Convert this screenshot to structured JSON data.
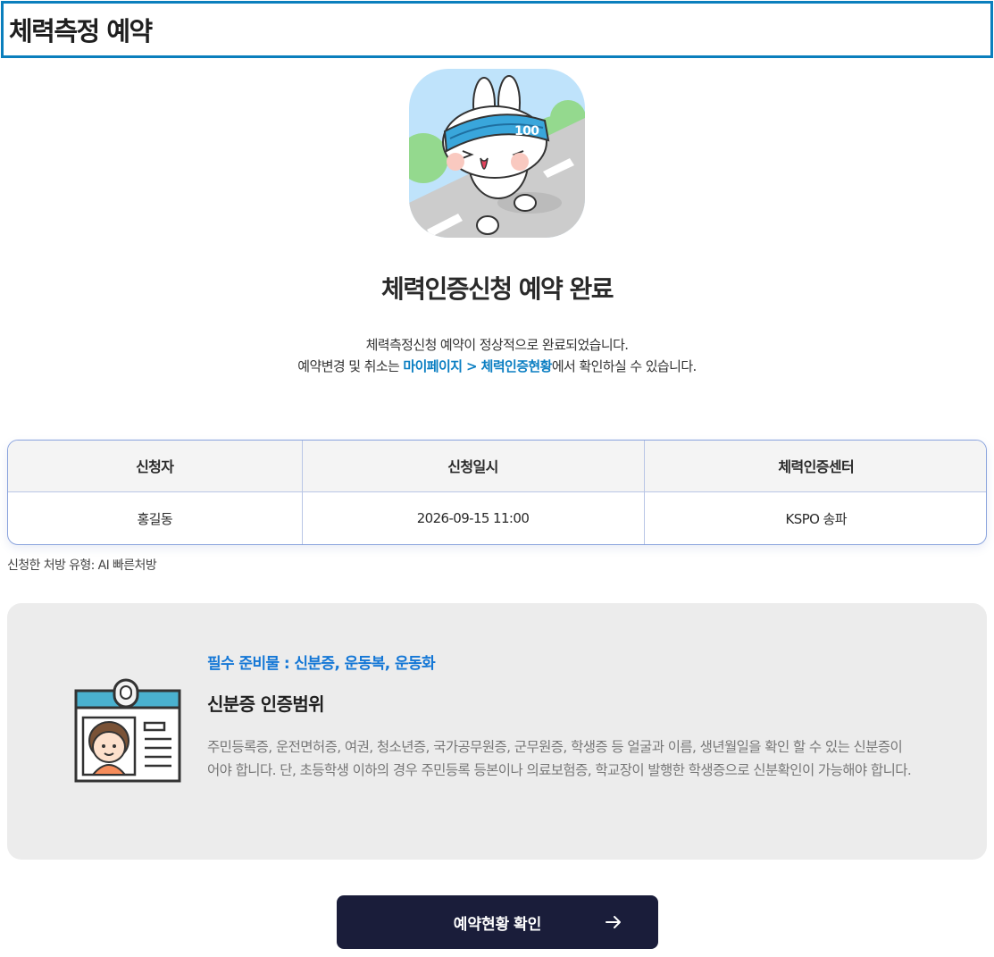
{
  "header": {
    "title": "체력측정 예약"
  },
  "completion": {
    "title": "체력인증신청 예약 완료",
    "line1": "체력측정신청 예약이 정상적으로 완료되었습니다.",
    "line2_prefix": "예약변경 및 취소는 ",
    "line2_link": "마이페이지 > 체력인증현황",
    "line2_suffix": "에서 확인하실 수 있습니다.",
    "badge_text": "100"
  },
  "table": {
    "headers": [
      "신청자",
      "신청일시",
      "체력인증센터"
    ],
    "row": [
      "홍길동",
      "2026-09-15 11:00",
      "KSPO 송파"
    ]
  },
  "prescription_note": "신청한 처방 유형: AI 빠른처방",
  "prep": {
    "required": "필수 준비물 : 신분증, 운동복, 운동화",
    "heading": "신분증 인증범위",
    "body": "주민등록증, 운전면허증, 여권, 청소년증, 국가공무원증, 군무원증, 학생증 등 얼굴과 이름, 생년월일을 확인 할 수 있는 신분증이어야 합니다. 단, 초등학생 이하의 경우 주민등록 등본이나 의료보험증, 학교장이 발행한 학생증으로 신분확인이 가능해야 합니다."
  },
  "confirm_button": {
    "label": "예약현황 확인",
    "icon": "arrow-right-icon"
  },
  "colors": {
    "accent": "#0a7ec2",
    "required": "#1477d6",
    "button": "#1a1d3a",
    "header_border": "#0b7fbd"
  }
}
